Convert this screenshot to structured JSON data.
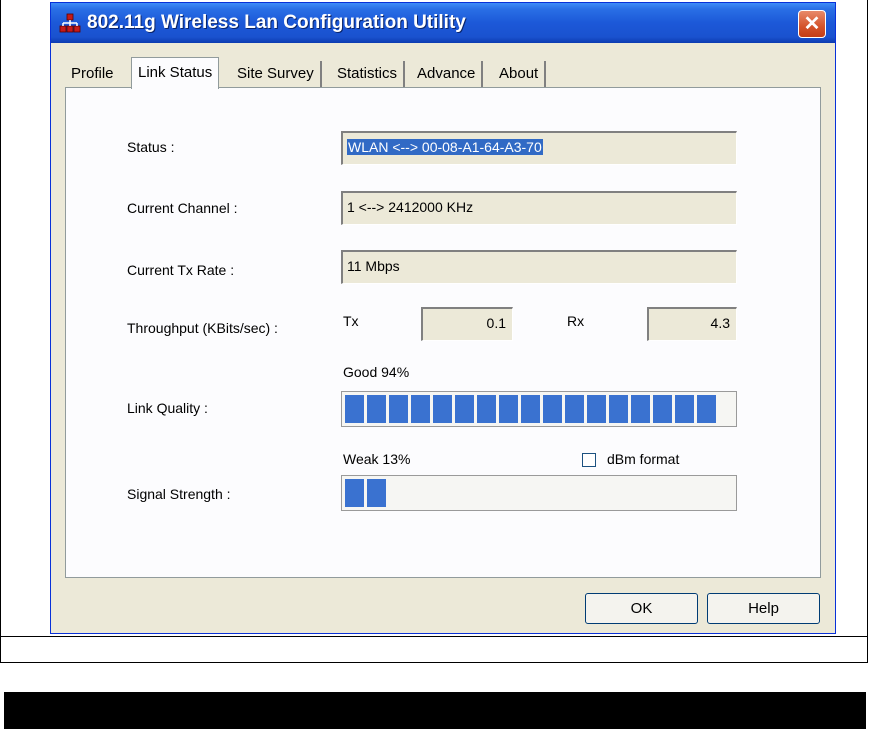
{
  "window": {
    "title": "802.11g Wireless Lan Configuration Utility",
    "close_label": "✕"
  },
  "tabs": [
    "Profile",
    "Link Status",
    "Site Survey",
    "Statistics",
    "Advance",
    "About"
  ],
  "active_tab": "Link Status",
  "link_status": {
    "status": {
      "label": "Status :",
      "value": "WLAN <--> 00-08-A1-64-A3-70"
    },
    "channel": {
      "label": "Current Channel :",
      "value": "1 <--> 2412000 KHz"
    },
    "tx_rate": {
      "label": "Current Tx Rate :",
      "value": "11 Mbps"
    },
    "throughput": {
      "label": "Throughput (KBits/sec) :",
      "tx_label": "Tx",
      "tx_value": "0.1",
      "rx_label": "Rx",
      "rx_value": "4.3"
    },
    "link_quality": {
      "label": "Link Quality :",
      "caption": "Good 94%",
      "percent": 94
    },
    "signal_strength": {
      "label": "Signal Strength :",
      "caption": "Weak 13%",
      "percent": 13
    },
    "dbm_format": {
      "label": "dBm format",
      "checked": false
    }
  },
  "buttons": {
    "ok": "OK",
    "help": "Help"
  },
  "colors": {
    "progress_fill": "#3a72d0",
    "selection": "#316ac5",
    "titlebar": "#1c58d8",
    "close": "#d4532b"
  }
}
